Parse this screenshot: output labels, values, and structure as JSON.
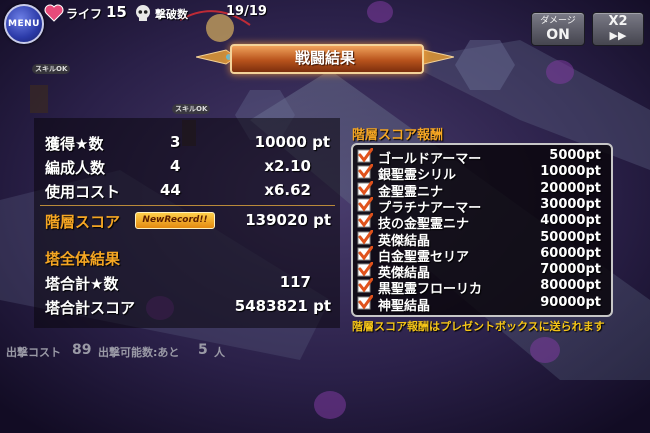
{
  "hud": {
    "menu_label": "MENU",
    "life_label": "ライフ",
    "life_value": "15",
    "kills_label": "撃破数",
    "kills_value": "19/19",
    "damage_button": {
      "line1": "ダメージ",
      "line2": "ON"
    },
    "speed_button": {
      "line1": "X2",
      "line2": "▶▶"
    }
  },
  "result": {
    "title": "戦闘結果",
    "stats": [
      {
        "label": "獲得★数",
        "count": "3",
        "value": "10000 pt"
      },
      {
        "label": "編成人数",
        "count": "4",
        "value": "x2.10"
      },
      {
        "label": "使用コスト",
        "count": "44",
        "value": "x6.62"
      }
    ],
    "floor_score_label": "階層スコア",
    "new_record_badge": "NewRecord!!",
    "floor_score_value": "139020 pt",
    "tower_section_title": "塔全体結果",
    "tower_total_stars_label": "塔合計★数",
    "tower_total_stars_value": "117",
    "tower_total_score_label": "塔合計スコア",
    "tower_total_score_value": "5483821 pt"
  },
  "rewards": {
    "title": "階層スコア報酬",
    "items": [
      {
        "name": "ゴールドアーマー",
        "points": "5000pt",
        "checked": true
      },
      {
        "name": "銀聖霊シリル",
        "points": "10000pt",
        "checked": true
      },
      {
        "name": "金聖霊ニナ",
        "points": "20000pt",
        "checked": true
      },
      {
        "name": "プラチナアーマー",
        "points": "30000pt",
        "checked": true
      },
      {
        "name": "技の金聖霊ニナ",
        "points": "40000pt",
        "checked": true
      },
      {
        "name": "英傑結晶",
        "points": "50000pt",
        "checked": true
      },
      {
        "name": "白金聖霊セリア",
        "points": "60000pt",
        "checked": true
      },
      {
        "name": "英傑結晶",
        "points": "70000pt",
        "checked": true
      },
      {
        "name": "黒聖霊フローリカ",
        "points": "80000pt",
        "checked": true
      },
      {
        "name": "神聖結晶",
        "points": "90000pt",
        "checked": true
      }
    ],
    "note": "階層スコア報酬はプレゼントボックスに送られます"
  },
  "bottom": {
    "cost_label": "出撃コスト",
    "cost_value": "89",
    "remaining_label": "出撃可能数:あと",
    "remaining_value": "5",
    "remaining_unit": "人"
  },
  "map_labels": {
    "skill_ok": "スキルOK"
  },
  "colors": {
    "accent": "#f5a623",
    "check": "#e0521c",
    "note": "#f5c518"
  }
}
